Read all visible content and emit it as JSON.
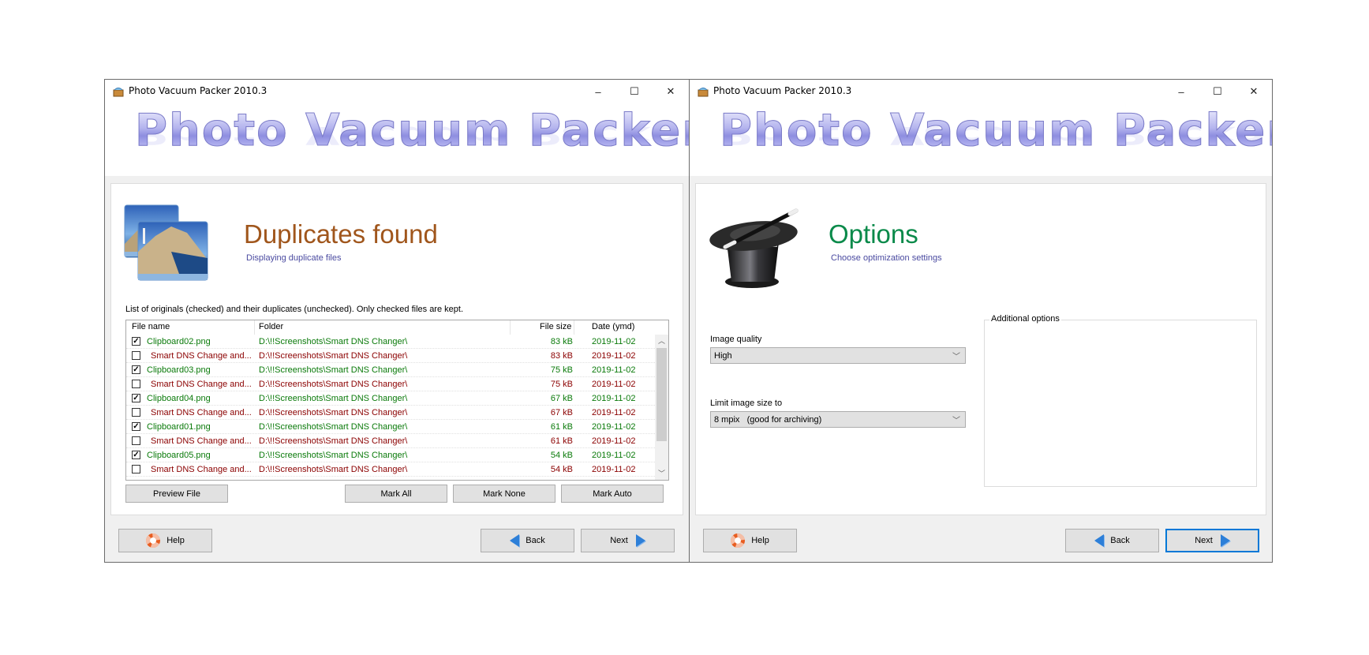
{
  "windows": [
    {
      "title": "Photo Vacuum Packer 2010.3",
      "banner": "Photo Vacuum Packer",
      "controls": {
        "minimize": "–",
        "maximize": "☐",
        "close": "✕"
      },
      "page": {
        "title": "Duplicates found",
        "title_color": "#a0561c",
        "subtitle": "Displaying duplicate files",
        "icon": "photos-icon"
      },
      "list": {
        "caption": "List of originals (checked) and their duplicates (unchecked). Only checked files are kept.",
        "columns": [
          "File name",
          "Folder",
          "File size",
          "Date (ymd)"
        ],
        "rows": [
          {
            "checked": true,
            "name": "Clipboard02.png",
            "folder": "D:\\!!Screenshots\\Smart DNS Changer\\",
            "size": "83 kB",
            "date": "2019-11-02"
          },
          {
            "checked": false,
            "name": "Smart DNS Change and...",
            "folder": "D:\\!!Screenshots\\Smart DNS Changer\\",
            "size": "83 kB",
            "date": "2019-11-02"
          },
          {
            "checked": true,
            "name": "Clipboard03.png",
            "folder": "D:\\!!Screenshots\\Smart DNS Changer\\",
            "size": "75 kB",
            "date": "2019-11-02"
          },
          {
            "checked": false,
            "name": "Smart DNS Change and...",
            "folder": "D:\\!!Screenshots\\Smart DNS Changer\\",
            "size": "75 kB",
            "date": "2019-11-02"
          },
          {
            "checked": true,
            "name": "Clipboard04.png",
            "folder": "D:\\!!Screenshots\\Smart DNS Changer\\",
            "size": "67 kB",
            "date": "2019-11-02"
          },
          {
            "checked": false,
            "name": "Smart DNS Change and...",
            "folder": "D:\\!!Screenshots\\Smart DNS Changer\\",
            "size": "67 kB",
            "date": "2019-11-02"
          },
          {
            "checked": true,
            "name": "Clipboard01.png",
            "folder": "D:\\!!Screenshots\\Smart DNS Changer\\",
            "size": "61 kB",
            "date": "2019-11-02"
          },
          {
            "checked": false,
            "name": "Smart DNS Change and...",
            "folder": "D:\\!!Screenshots\\Smart DNS Changer\\",
            "size": "61 kB",
            "date": "2019-11-02"
          },
          {
            "checked": true,
            "name": "Clipboard05.png",
            "folder": "D:\\!!Screenshots\\Smart DNS Changer\\",
            "size": "54 kB",
            "date": "2019-11-02"
          },
          {
            "checked": false,
            "name": "Smart DNS Change and...",
            "folder": "D:\\!!Screenshots\\Smart DNS Changer\\",
            "size": "54 kB",
            "date": "2019-11-02"
          }
        ],
        "original_color": "#0a7a0a",
        "duplicate_color": "#8b0000"
      },
      "buttons": {
        "preview_file": "Preview File",
        "mark_all": "Mark All",
        "mark_none": "Mark None",
        "mark_auto": "Mark Auto",
        "help": "Help",
        "back": "Back",
        "next": "Next"
      }
    },
    {
      "title": "Photo Vacuum Packer 2010.3",
      "banner": "Photo Vacuum Packer",
      "controls": {
        "minimize": "–",
        "maximize": "☐",
        "close": "✕"
      },
      "page": {
        "title": "Options",
        "title_color": "#0a8a4a",
        "subtitle": "Choose optimization settings",
        "icon": "magic-hat-icon"
      },
      "image_quality": {
        "label": "Image quality",
        "value": "High"
      },
      "limit_size": {
        "label": "Limit image size to",
        "value": "8 mpix   (good for archiving)"
      },
      "additional_options": {
        "label": "Additional options"
      },
      "buttons": {
        "help": "Help",
        "back": "Back",
        "next": "Next"
      }
    }
  ]
}
